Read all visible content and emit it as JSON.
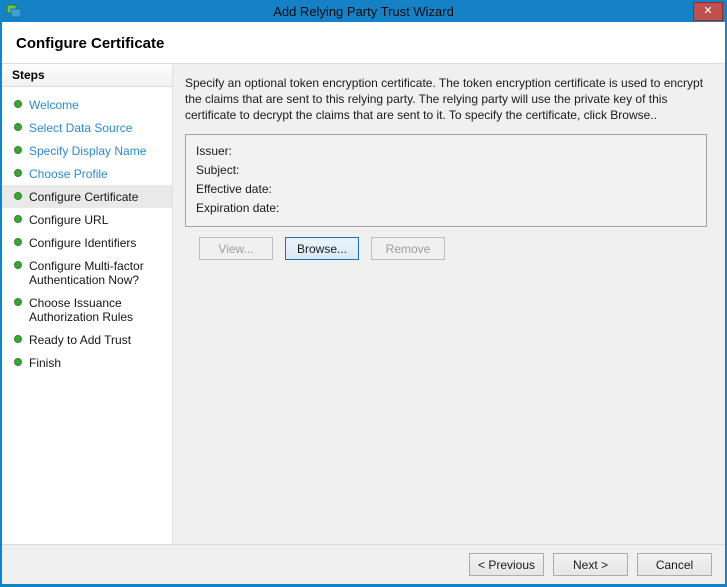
{
  "window": {
    "title": "Add Relying Party Trust Wizard",
    "close_glyph": "✕"
  },
  "header": {
    "title": "Configure Certificate"
  },
  "sidebar": {
    "header": "Steps",
    "steps": [
      {
        "label": "Welcome",
        "state": "completed"
      },
      {
        "label": "Select Data Source",
        "state": "completed"
      },
      {
        "label": "Specify Display Name",
        "state": "completed"
      },
      {
        "label": "Choose Profile",
        "state": "completed"
      },
      {
        "label": "Configure Certificate",
        "state": "current"
      },
      {
        "label": "Configure URL",
        "state": "upcoming"
      },
      {
        "label": "Configure Identifiers",
        "state": "upcoming"
      },
      {
        "label": "Configure Multi-factor Authentication Now?",
        "state": "upcoming"
      },
      {
        "label": "Choose Issuance Authorization Rules",
        "state": "upcoming"
      },
      {
        "label": "Ready to Add Trust",
        "state": "upcoming"
      },
      {
        "label": "Finish",
        "state": "upcoming"
      }
    ]
  },
  "content": {
    "description": "Specify an optional token encryption certificate.  The token encryption certificate is used to encrypt the claims that are sent to this relying party.  The relying party will use the private key of this certificate to decrypt the claims that are sent to it.  To specify the certificate, click Browse..",
    "certificate_fields": [
      {
        "label": "Issuer:",
        "value": ""
      },
      {
        "label": "Subject:",
        "value": ""
      },
      {
        "label": "Effective date:",
        "value": ""
      },
      {
        "label": "Expiration date:",
        "value": ""
      }
    ],
    "buttons": [
      {
        "label": "View...",
        "enabled": false
      },
      {
        "label": "Browse...",
        "enabled": true
      },
      {
        "label": "Remove",
        "enabled": false
      }
    ]
  },
  "footer": {
    "previous_label": "< Previous",
    "next_label": "Next >",
    "cancel_label": "Cancel"
  },
  "colors": {
    "frame_blue": "#1581c6",
    "close_red": "#c0504d",
    "step_bullet_green": "#3ba437",
    "completed_step_blue": "#2b8ad0",
    "content_gray": "#f0f0f0"
  }
}
